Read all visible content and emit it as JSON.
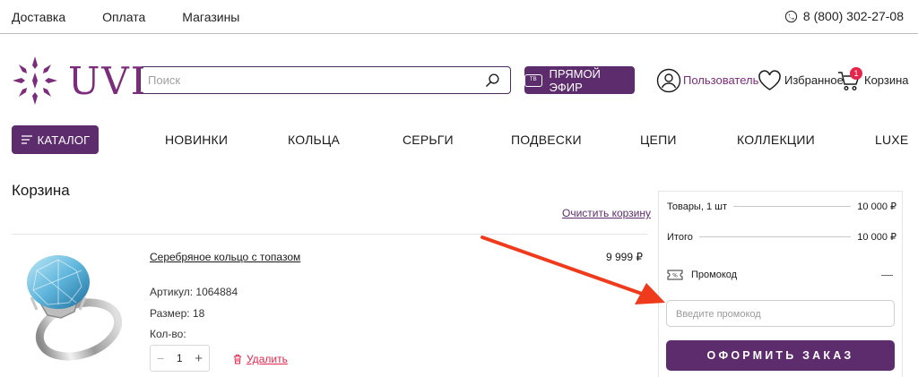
{
  "topbar": {
    "links": [
      "Доставка",
      "Оплата",
      "Магазины"
    ],
    "phone": "8 (800) 302-27-08",
    "phone_icon": "phone-icon"
  },
  "header": {
    "logo_text": "UVI",
    "search_placeholder": "Поиск",
    "live_button": "ПРЯМОЙ ЭФИР",
    "live_icon_text": "TB",
    "user_label": "Пользователь",
    "favorites_label": "Избранное",
    "cart_label": "Корзина",
    "cart_count": "1"
  },
  "nav": {
    "catalog_label": "КАТАЛОГ",
    "items": [
      "НОВИНКИ",
      "КОЛЬЦА",
      "СЕРЬГИ",
      "ПОДВЕСКИ",
      "ЦЕПИ",
      "КОЛЛЕКЦИИ",
      "LUXE"
    ]
  },
  "cart": {
    "title": "Корзина",
    "clear_link": "Очистить корзину",
    "item": {
      "name": "Серебряное кольцо с топазом",
      "price": "9 999 ₽",
      "sku": "Артикул: 1064884",
      "size": "Размер: 18",
      "qty_label": "Кол-во:",
      "qty": "1",
      "minus": "−",
      "plus": "+",
      "delete_label": "Удалить"
    }
  },
  "summary": {
    "items_label": "Товары, 1 шт",
    "items_value": "10 000 ₽",
    "total_label": "Итого",
    "total_value": "10 000 ₽",
    "promo_label": "Промокод",
    "promo_icon_text": "%",
    "promo_toggle": "—",
    "promo_placeholder": "Введите промокод",
    "order_button": "ОФОРМИТЬ ЗАКАЗ"
  },
  "colors": {
    "brand": "#5c2c6c",
    "accent": "#7b2d7b",
    "danger": "#e6254c",
    "annotation_arrow": "#f03a1c"
  }
}
